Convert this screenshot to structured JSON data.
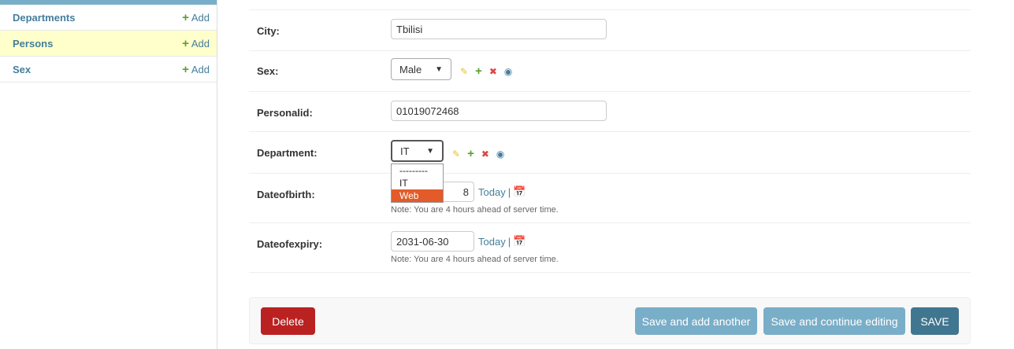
{
  "sidebar": {
    "items": [
      {
        "name": "Departments",
        "add": "Add"
      },
      {
        "name": "Persons",
        "add": "Add"
      },
      {
        "name": "Sex",
        "add": "Add"
      }
    ]
  },
  "form": {
    "city": {
      "label": "City:",
      "value": "Tbilisi"
    },
    "sex": {
      "label": "Sex:",
      "value": "Male"
    },
    "personalid": {
      "label": "Personalid:",
      "value": "01019072468"
    },
    "department": {
      "label": "Department:",
      "value": "IT",
      "options": [
        "---------",
        "IT",
        "Web"
      ],
      "highlighted": "Web"
    },
    "dateofbirth": {
      "label": "Dateofbirth:",
      "value_suffix": "8",
      "today": "Today",
      "separator": "|",
      "note": "Note: You are 4 hours ahead of server time."
    },
    "dateofexpiry": {
      "label": "Dateofexpiry:",
      "value": "2031-06-30",
      "today": "Today",
      "separator": "|",
      "note": "Note: You are 4 hours ahead of server time."
    }
  },
  "buttons": {
    "delete": "Delete",
    "save_add": "Save and add another",
    "save_continue": "Save and continue editing",
    "save": "SAVE"
  },
  "colors": {
    "link": "#447e9b",
    "delete": "#ba2121",
    "secondary_button": "#79aec8",
    "primary_button": "#417690",
    "highlight_option": "#e25b29",
    "active_row": "#ffffcc"
  }
}
